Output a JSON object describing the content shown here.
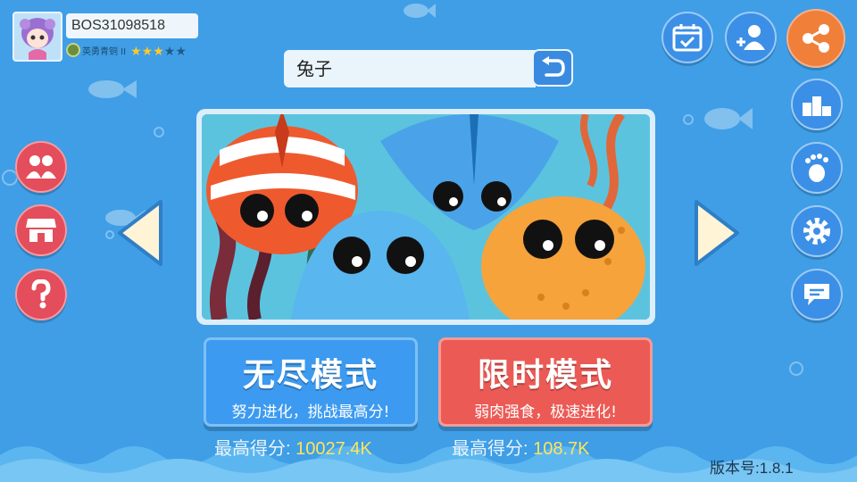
{
  "player": {
    "id": "BOS31098518",
    "rank_name": "英勇青铜 II",
    "stars_filled": 3,
    "stars_total": 5
  },
  "search": {
    "value": "兔子"
  },
  "modes": {
    "endless": {
      "title": "无尽模式",
      "subtitle": "努力进化，挑战最高分!",
      "score_label": "最高得分:",
      "score_value": "10027.4K"
    },
    "timed": {
      "title": "限时模式",
      "subtitle": "弱肉强食，极速进化!",
      "score_label": "最高得分:",
      "score_value": "108.7K"
    }
  },
  "version": "版本号:1.8.1",
  "icons": {
    "left": [
      "friends-icon",
      "shop-icon",
      "help-icon"
    ],
    "top_right": [
      "calendar-check-icon",
      "add-friend-icon",
      "share-icon"
    ],
    "right": [
      "leaderboard-icon",
      "footprint-icon",
      "settings-icon",
      "chat-icon"
    ]
  },
  "colors": {
    "background": "#3f9ee6",
    "endless_button": "#3c9af0",
    "timed_button": "#ec5a55",
    "score_value": "#ffe45a",
    "side_button_red": "#e44d5b",
    "side_button_blue": "#3c8fe6",
    "share_button": "#f07f3a"
  }
}
